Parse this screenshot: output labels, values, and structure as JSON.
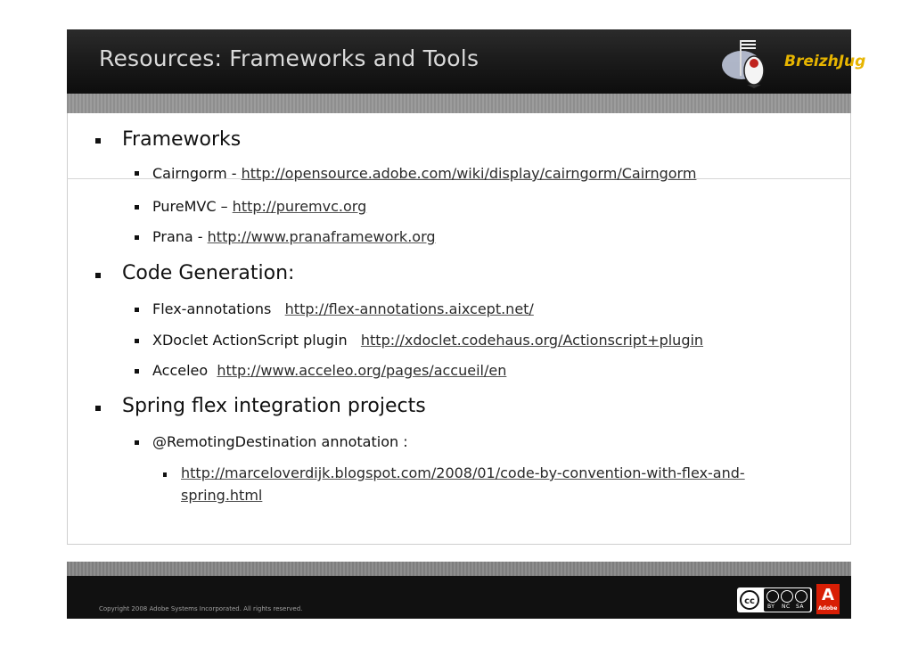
{
  "slide": {
    "title": "Resources: Frameworks and Tools",
    "logo_text": "BreizhJug",
    "sections": [
      {
        "heading": "Frameworks",
        "items": [
          {
            "name": "Cairngorm",
            "sep": " - ",
            "url": "http://opensource.adobe.com/wiki/display/cairngorm/Cairngorm"
          },
          {
            "name": "PureMVC",
            "sep": " – ",
            "url": "http://puremvc.org"
          },
          {
            "name": "Prana",
            "sep": " - ",
            "url": "http://www.pranaframework.org"
          }
        ]
      },
      {
        "heading": "Code Generation:",
        "items": [
          {
            "name": "Flex-annotations",
            "sep": "   ",
            "url": "http://flex-annotations.aixcept.net/"
          },
          {
            "name": "XDoclet ActionScript plugin",
            "sep": "   ",
            "url": "http://xdoclet.codehaus.org/Actionscript+plugin"
          },
          {
            "name": "Acceleo",
            "sep": "  ",
            "url": "http://www.acceleo.org/pages/accueil/en"
          }
        ]
      },
      {
        "heading": "Spring flex integration projects",
        "items": [
          {
            "name": "@RemotingDestination annotation :"
          }
        ],
        "subitems": [
          {
            "url_line1": "http://marceloverdijk.blogspot.com/2008/01/code-by-convention-with-flex-and-",
            "url_line2": "spring.html"
          }
        ]
      }
    ]
  },
  "footer": {
    "copyright": "Copyright 2008 Adobe Systems Incorporated.  All rights reserved.",
    "cc_label": "cc",
    "cc_terms": [
      "BY",
      "NC",
      "SA"
    ],
    "adobe_label": "Adobe"
  },
  "colors": {
    "header_bg": "#1c1c1c",
    "title_text": "#dadada",
    "logo_accent": "#e7b500",
    "adobe_red": "#d81e05"
  }
}
